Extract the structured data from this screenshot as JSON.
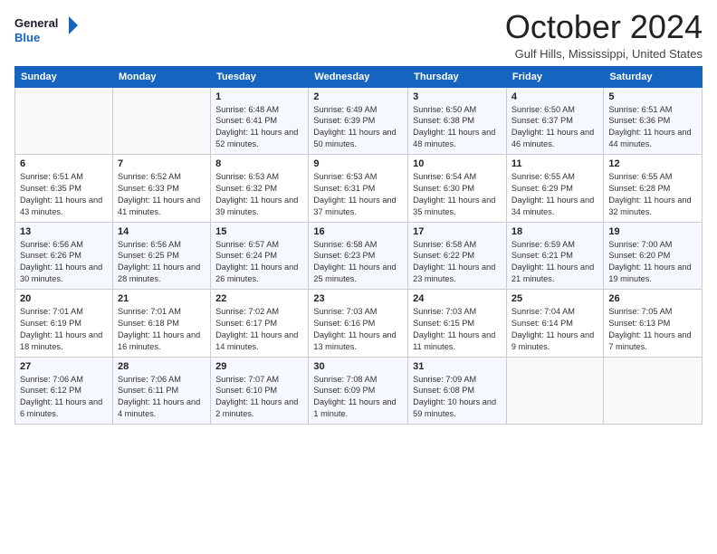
{
  "logo": {
    "line1": "General",
    "line2": "Blue"
  },
  "title": "October 2024",
  "location": "Gulf Hills, Mississippi, United States",
  "weekdays": [
    "Sunday",
    "Monday",
    "Tuesday",
    "Wednesday",
    "Thursday",
    "Friday",
    "Saturday"
  ],
  "weeks": [
    [
      {
        "day": "",
        "detail": ""
      },
      {
        "day": "",
        "detail": ""
      },
      {
        "day": "1",
        "detail": "Sunrise: 6:48 AM\nSunset: 6:41 PM\nDaylight: 11 hours and 52 minutes."
      },
      {
        "day": "2",
        "detail": "Sunrise: 6:49 AM\nSunset: 6:39 PM\nDaylight: 11 hours and 50 minutes."
      },
      {
        "day": "3",
        "detail": "Sunrise: 6:50 AM\nSunset: 6:38 PM\nDaylight: 11 hours and 48 minutes."
      },
      {
        "day": "4",
        "detail": "Sunrise: 6:50 AM\nSunset: 6:37 PM\nDaylight: 11 hours and 46 minutes."
      },
      {
        "day": "5",
        "detail": "Sunrise: 6:51 AM\nSunset: 6:36 PM\nDaylight: 11 hours and 44 minutes."
      }
    ],
    [
      {
        "day": "6",
        "detail": "Sunrise: 6:51 AM\nSunset: 6:35 PM\nDaylight: 11 hours and 43 minutes."
      },
      {
        "day": "7",
        "detail": "Sunrise: 6:52 AM\nSunset: 6:33 PM\nDaylight: 11 hours and 41 minutes."
      },
      {
        "day": "8",
        "detail": "Sunrise: 6:53 AM\nSunset: 6:32 PM\nDaylight: 11 hours and 39 minutes."
      },
      {
        "day": "9",
        "detail": "Sunrise: 6:53 AM\nSunset: 6:31 PM\nDaylight: 11 hours and 37 minutes."
      },
      {
        "day": "10",
        "detail": "Sunrise: 6:54 AM\nSunset: 6:30 PM\nDaylight: 11 hours and 35 minutes."
      },
      {
        "day": "11",
        "detail": "Sunrise: 6:55 AM\nSunset: 6:29 PM\nDaylight: 11 hours and 34 minutes."
      },
      {
        "day": "12",
        "detail": "Sunrise: 6:55 AM\nSunset: 6:28 PM\nDaylight: 11 hours and 32 minutes."
      }
    ],
    [
      {
        "day": "13",
        "detail": "Sunrise: 6:56 AM\nSunset: 6:26 PM\nDaylight: 11 hours and 30 minutes."
      },
      {
        "day": "14",
        "detail": "Sunrise: 6:56 AM\nSunset: 6:25 PM\nDaylight: 11 hours and 28 minutes."
      },
      {
        "day": "15",
        "detail": "Sunrise: 6:57 AM\nSunset: 6:24 PM\nDaylight: 11 hours and 26 minutes."
      },
      {
        "day": "16",
        "detail": "Sunrise: 6:58 AM\nSunset: 6:23 PM\nDaylight: 11 hours and 25 minutes."
      },
      {
        "day": "17",
        "detail": "Sunrise: 6:58 AM\nSunset: 6:22 PM\nDaylight: 11 hours and 23 minutes."
      },
      {
        "day": "18",
        "detail": "Sunrise: 6:59 AM\nSunset: 6:21 PM\nDaylight: 11 hours and 21 minutes."
      },
      {
        "day": "19",
        "detail": "Sunrise: 7:00 AM\nSunset: 6:20 PM\nDaylight: 11 hours and 19 minutes."
      }
    ],
    [
      {
        "day": "20",
        "detail": "Sunrise: 7:01 AM\nSunset: 6:19 PM\nDaylight: 11 hours and 18 minutes."
      },
      {
        "day": "21",
        "detail": "Sunrise: 7:01 AM\nSunset: 6:18 PM\nDaylight: 11 hours and 16 minutes."
      },
      {
        "day": "22",
        "detail": "Sunrise: 7:02 AM\nSunset: 6:17 PM\nDaylight: 11 hours and 14 minutes."
      },
      {
        "day": "23",
        "detail": "Sunrise: 7:03 AM\nSunset: 6:16 PM\nDaylight: 11 hours and 13 minutes."
      },
      {
        "day": "24",
        "detail": "Sunrise: 7:03 AM\nSunset: 6:15 PM\nDaylight: 11 hours and 11 minutes."
      },
      {
        "day": "25",
        "detail": "Sunrise: 7:04 AM\nSunset: 6:14 PM\nDaylight: 11 hours and 9 minutes."
      },
      {
        "day": "26",
        "detail": "Sunrise: 7:05 AM\nSunset: 6:13 PM\nDaylight: 11 hours and 7 minutes."
      }
    ],
    [
      {
        "day": "27",
        "detail": "Sunrise: 7:06 AM\nSunset: 6:12 PM\nDaylight: 11 hours and 6 minutes."
      },
      {
        "day": "28",
        "detail": "Sunrise: 7:06 AM\nSunset: 6:11 PM\nDaylight: 11 hours and 4 minutes."
      },
      {
        "day": "29",
        "detail": "Sunrise: 7:07 AM\nSunset: 6:10 PM\nDaylight: 11 hours and 2 minutes."
      },
      {
        "day": "30",
        "detail": "Sunrise: 7:08 AM\nSunset: 6:09 PM\nDaylight: 11 hours and 1 minute."
      },
      {
        "day": "31",
        "detail": "Sunrise: 7:09 AM\nSunset: 6:08 PM\nDaylight: 10 hours and 59 minutes."
      },
      {
        "day": "",
        "detail": ""
      },
      {
        "day": "",
        "detail": ""
      }
    ]
  ]
}
